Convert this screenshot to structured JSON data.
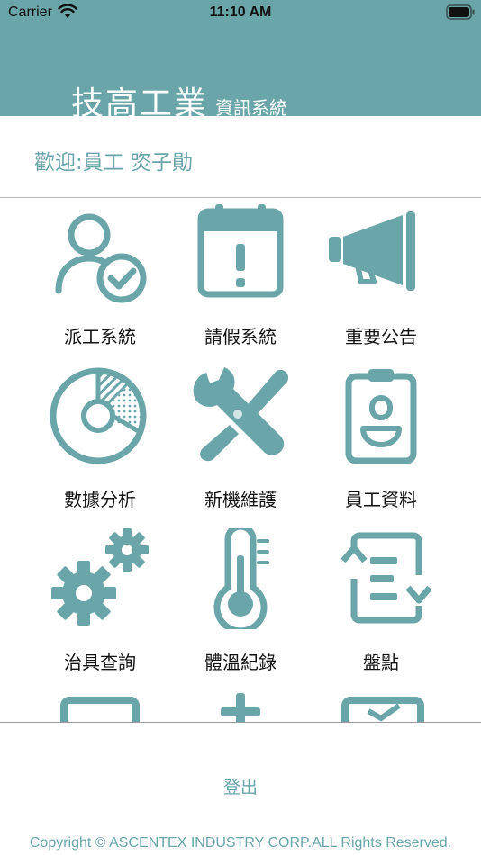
{
  "status_bar": {
    "carrier": "Carrier",
    "time": "11:10 AM"
  },
  "header": {
    "brand_main": "技高工業",
    "brand_sub": "資訊系統",
    "color": "#6aa5a9"
  },
  "welcome": "歡迎:員工 焁子勛",
  "menu": [
    {
      "label": "派工系統",
      "icon": "user-check-icon"
    },
    {
      "label": "請假系統",
      "icon": "calendar-alert-icon"
    },
    {
      "label": "重要公告",
      "icon": "megaphone-icon"
    },
    {
      "label": "數據分析",
      "icon": "pie-chart-icon"
    },
    {
      "label": "新機維護",
      "icon": "tools-icon"
    },
    {
      "label": "員工資料",
      "icon": "id-badge-icon"
    },
    {
      "label": "治具查詢",
      "icon": "gears-icon"
    },
    {
      "label": "體溫紀錄",
      "icon": "thermometer-icon"
    },
    {
      "label": "盤點",
      "icon": "inventory-list-icon"
    }
  ],
  "footer": {
    "logout_label": "登出",
    "copyright": "Copyright © ASCENTEX INDUSTRY CORP.ALL Rights Reserved."
  }
}
